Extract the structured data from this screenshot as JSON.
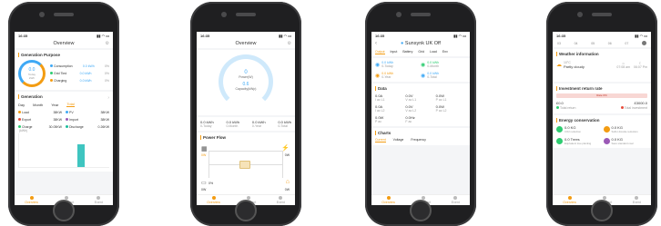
{
  "phones": [
    {
      "status_time": "16:35",
      "title": "Overview",
      "generation_purpose": {
        "title": "Generation Purpose",
        "donut_value": "0.0",
        "donut_label": "Today",
        "donut_unit": "kWh",
        "legend": [
          {
            "label": "Consumption",
            "value": "0.0 kWh",
            "pct": "0%",
            "color": "#3fa9f5"
          },
          {
            "label": "Grid Tied",
            "value": "0.0 kWh",
            "pct": "0%",
            "color": "#2ecc71"
          },
          {
            "label": "Charging",
            "value": "0.0 kWh",
            "pct": "0%",
            "color": "#f39c12"
          }
        ]
      },
      "generation": {
        "title": "Generation",
        "tabs": [
          "Day",
          "Month",
          "Year",
          "Total"
        ],
        "stats": [
          {
            "label": "Load",
            "value": "38KW"
          },
          {
            "label": "PV",
            "value": "38KW"
          },
          {
            "label": "Export",
            "value": "38KW"
          },
          {
            "label": "Import",
            "value": "38KW"
          },
          {
            "label": "Charge",
            "value": "30.05KW"
          },
          {
            "label": "Discharge",
            "value": "0.26KW"
          }
        ],
        "yaxis_label": "(kWh)"
      },
      "tabbar": [
        "Overview",
        "Equipment",
        "Event"
      ]
    },
    {
      "status_time": "16:35",
      "title": "Overview",
      "gauge_value": "0",
      "gauge_label": "Power(W)",
      "capacity_value": "0.6",
      "capacity_label": "Capacity(kWp)",
      "stats": [
        {
          "value": "0.0 kWh",
          "label": "0-Today"
        },
        {
          "value": "0.0 kWh",
          "label": "0-Month"
        },
        {
          "value": "0.0 kWh",
          "label": "0-Year"
        },
        {
          "value": "0.0 kWh",
          "label": "0-Total"
        }
      ],
      "power_flow": {
        "title": "Power Flow",
        "pv": "0W",
        "grid": "0W",
        "battery_pct": "0%",
        "battery_w": "0W",
        "load": "0W"
      },
      "tabbar": [
        "Overview",
        "Equipment",
        "Event"
      ]
    },
    {
      "status_time": "16:35",
      "title": "Sunsynk UK Off",
      "tabs": [
        "Output",
        "Input",
        "Battery",
        "Grid",
        "Load",
        "Env"
      ],
      "energy": [
        {
          "value": "0.0 kWh",
          "label": "0-Today"
        },
        {
          "value": "0.0 kWh",
          "label": "0-Month"
        },
        {
          "value": "0.0 kWh",
          "label": "0-Year"
        },
        {
          "value": "0.0 kWh",
          "label": "0-Total"
        }
      ],
      "data": {
        "title": "Data",
        "rows": [
          [
            {
              "value": "0.0A",
              "label": "I ac L1"
            },
            {
              "value": "0.0V",
              "label": "V ac L1"
            },
            {
              "value": "0.0W",
              "label": "P ac L1"
            }
          ],
          [
            {
              "value": "0.0A",
              "label": "I ac L2"
            },
            {
              "value": "0.0V",
              "label": "V ac L2"
            },
            {
              "value": "0.0W",
              "label": "P ac L2"
            }
          ],
          [
            {
              "value": "0.0W",
              "label": "P ac"
            },
            {
              "value": "0.0Hz",
              "label": "F ac"
            }
          ]
        ]
      },
      "charts": {
        "title": "Charts",
        "tabs": [
          "Current",
          "Voltage",
          "Frequency"
        ]
      },
      "tabbar": [
        "Overview",
        "Equipment",
        "Event"
      ]
    },
    {
      "status_time": "16:35",
      "date_strip": [
        "03",
        "04",
        "05",
        "06",
        "07"
      ],
      "weather": {
        "title": "Weather information",
        "temp": "10°C",
        "condition": "Partly cloudy",
        "sunrise": "07:08 am",
        "sunset": "06:07 Pm"
      },
      "investment": {
        "title": "Investment return rate",
        "rate_label": "Rate 0%",
        "total_return_value": "£0.0",
        "total_return_label": "Total return",
        "total_investment_value": "£3000.0",
        "total_investment_label": "Total investment"
      },
      "energy_conservation": {
        "title": "Energy conservation",
        "items": [
          {
            "value": "0.0 KG",
            "label": "CO2 reduction",
            "color": "#2ecc71"
          },
          {
            "value": "0.0 KG",
            "label": "Sulfur dioxide reduction",
            "color": "#f39c12"
          },
          {
            "value": "0.0 Trees",
            "label": "Equivalent tree planting",
            "color": "#2ecc71"
          },
          {
            "value": "0.0 KG",
            "label": "Save standard coal",
            "color": "#9b59b6"
          }
        ]
      },
      "tabbar": [
        "Overview",
        "Equipment",
        "Event"
      ]
    }
  ]
}
